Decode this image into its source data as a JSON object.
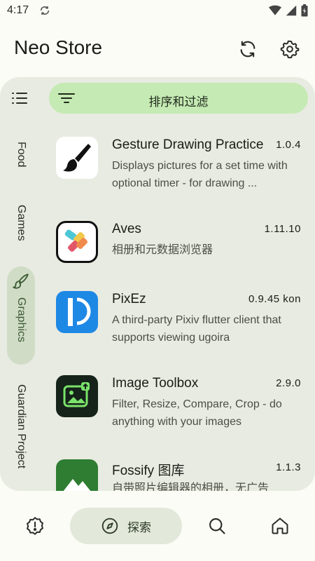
{
  "status_bar": {
    "time": "4:17"
  },
  "header": {
    "title": "Neo Store"
  },
  "filter": {
    "label": "排序和过滤"
  },
  "categories": [
    {
      "label": "Food",
      "active": false
    },
    {
      "label": "Games",
      "active": false
    },
    {
      "label": "Graphics",
      "active": true
    },
    {
      "label": "Guardian Project",
      "active": false
    }
  ],
  "apps": [
    {
      "name": "Gesture Drawing Practice",
      "version": "1.0.4",
      "description": "Displays pictures for a set time with optional timer - for drawing ..."
    },
    {
      "name": "Aves",
      "version": "1.11.10",
      "description": "相册和元数据浏览器"
    },
    {
      "name": "PixEz",
      "version": "0.9.45 kon",
      "description": "A third-party Pixiv flutter client that supports viewing ugoira"
    },
    {
      "name": "Image Toolbox",
      "version": "2.9.0",
      "description": "Filter, Resize, Compare, Crop - do anything with your images"
    },
    {
      "name": "Fossify 图库",
      "version": "1.1.3",
      "description": "自带照片编辑器的相册，无广告"
    }
  ],
  "bottom_nav": {
    "explore_label": "探索"
  },
  "colors": {
    "accent": "#c5eab4",
    "panel": "#e8ebe1",
    "rail_active": "#d0dcc6"
  }
}
